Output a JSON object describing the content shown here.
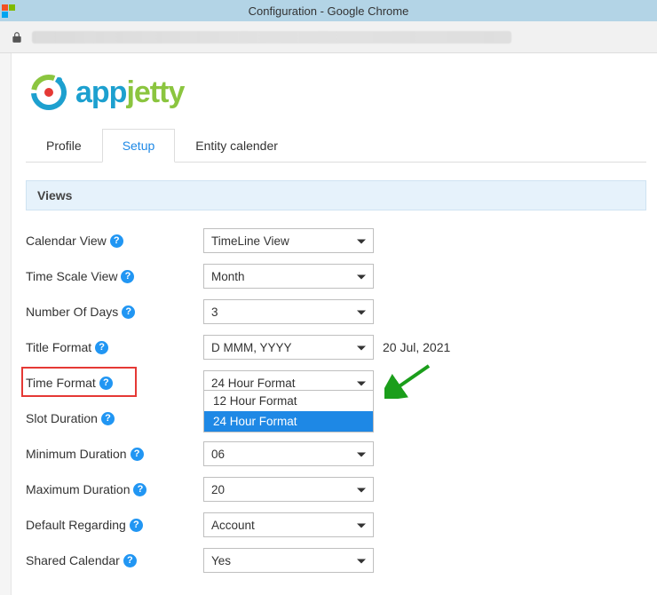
{
  "window": {
    "title": "Configuration - Google Chrome"
  },
  "logo": {
    "part1": "app",
    "part2": "jetty"
  },
  "tabs": [
    {
      "id": "profile",
      "label": "Profile",
      "active": false
    },
    {
      "id": "setup",
      "label": "Setup",
      "active": true
    },
    {
      "id": "entity-calendar",
      "label": "Entity calender",
      "active": false
    }
  ],
  "section": {
    "title": "Views"
  },
  "fields": {
    "calendarView": {
      "label": "Calendar View",
      "value": "TimeLine View"
    },
    "timeScaleView": {
      "label": "Time Scale View",
      "value": "Month"
    },
    "numberOfDays": {
      "label": "Number Of Days",
      "value": "3"
    },
    "titleFormat": {
      "label": "Title Format",
      "value": "D MMM, YYYY",
      "hint": "20 Jul, 2021"
    },
    "timeFormat": {
      "label": "Time Format",
      "value": "24 Hour Format",
      "options": [
        "12 Hour Format",
        "24 Hour Format"
      ],
      "selectedIndex": 1
    },
    "slotDuration": {
      "label": "Slot Duration"
    },
    "minimumDuration": {
      "label": "Minimum Duration",
      "value": "06"
    },
    "maximumDuration": {
      "label": "Maximum Duration",
      "value": "20"
    },
    "defaultRegarding": {
      "label": "Default Regarding",
      "value": "Account"
    },
    "sharedCalendar": {
      "label": "Shared Calendar",
      "value": "Yes"
    }
  }
}
